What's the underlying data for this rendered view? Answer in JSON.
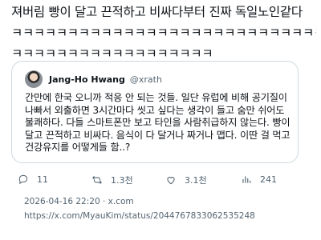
{
  "tweet": {
    "line1": "져버림 빵이 달고 끈적하고 비싸다부터 진짜 독일노인같다",
    "line2": "ㅋㅋㅋㅋㅋㅋㅋㅋㅋㅋㅋㅋㅋㅋㅋㅋㅋㅋㅋㅋㅋㅋㅋㅋㅋㅋㅋㅋ",
    "line3": "ㅋㅋㅋㅋㅋㅋㅋㅋㅋㅋㅋㅋㅋㅋㅋㅋㅋㅋ"
  },
  "quote": {
    "name": "Jang-Ho Hwang",
    "handle": "@xrath",
    "text": "간만에 한국 오니까 적응 안 되는 것들. 일단 유럽에 비해 공기질이 나빠서 외출하면 3시간마다 씻고 싶다는 생각이 들고 숨만 쉬어도 불쾌하다. 다들 스마트폰만 보고 타인을 사람취급하지 않는다. 빵이 달고 끈적하고 비싸다. 음식이 다 달거나 짜거나 맵다. 이딴 걸 먹고 건강유지를 어떻게들 함..?"
  },
  "actions": {
    "replies": "11",
    "reposts": "1.3천",
    "likes": "3.1천",
    "views": "241"
  },
  "meta": {
    "timestamp": "2026-04-16 22:20 · x.com",
    "url": "https://x.com/MyauKim/status/2044767833062535248"
  },
  "icons": [
    "reply-icon",
    "repost-icon",
    "like-icon",
    "views-icon"
  ],
  "colors": {
    "border": "#cfd9de",
    "secondary": "#536471",
    "text": "#0f1419"
  }
}
